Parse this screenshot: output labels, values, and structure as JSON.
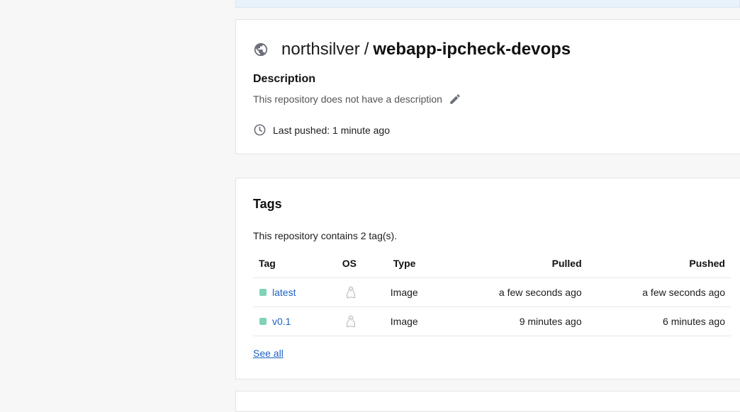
{
  "repo": {
    "namespace": "northsilver",
    "separator": "/",
    "name": "webapp-ipcheck-devops",
    "description_heading": "Description",
    "description_text": "This repository does not have a description",
    "last_pushed": "Last pushed: 1 minute ago"
  },
  "tags": {
    "heading": "Tags",
    "count_text": "This repository contains 2 tag(s).",
    "columns": {
      "tag": "Tag",
      "os": "OS",
      "type": "Type",
      "pulled": "Pulled",
      "pushed": "Pushed"
    },
    "rows": [
      {
        "tag": "latest",
        "os_icon": "linux-icon",
        "type": "Image",
        "pulled": "a few seconds ago",
        "pushed": "a few seconds ago"
      },
      {
        "tag": "v0.1",
        "os_icon": "linux-icon",
        "type": "Image",
        "pulled": "9 minutes ago",
        "pushed": "6 minutes ago"
      }
    ],
    "see_all": "See all"
  },
  "colors": {
    "link": "#1d63c6",
    "status_dot": "#7fd3b5",
    "icon_gray": "#6b6f7a",
    "banner": "#e9f2fb"
  }
}
